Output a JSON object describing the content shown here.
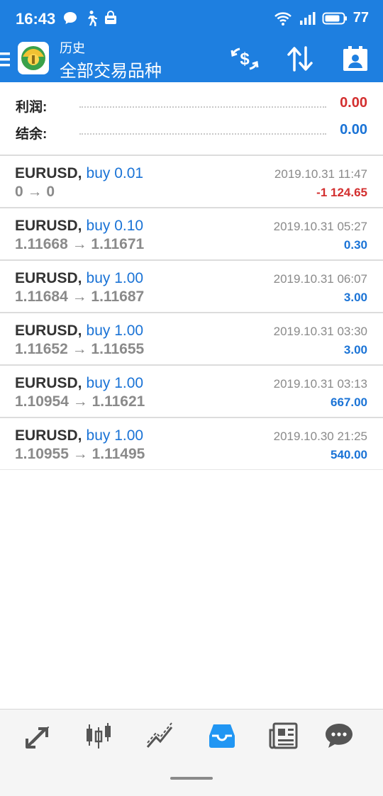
{
  "status_bar": {
    "time": "16:43",
    "battery": "77",
    "icons_left": [
      "chat-bubble-icon",
      "walking-icon",
      "bag-icon"
    ],
    "icons_right": [
      "wifi-icon",
      "signal-icon",
      "battery-icon"
    ]
  },
  "header": {
    "subtitle": "历史",
    "title": "全部交易品种",
    "actions": [
      "currency-exchange-icon",
      "sort-icon",
      "calendar-icon"
    ]
  },
  "summary": {
    "profit_label": "利润:",
    "profit_value": "0.00",
    "balance_label": "结余:",
    "balance_value": "0.00"
  },
  "trades": [
    {
      "symbol": "EURUSD,",
      "action": "buy 0.01",
      "prices": "0 → 0",
      "date": "2019.10.31 11:47",
      "profit": "-1 124.65",
      "profit_color": "#d32f2f"
    },
    {
      "symbol": "EURUSD,",
      "action": "buy 0.10",
      "prices": "1.11668 → 1.11671",
      "date": "2019.10.31 05:27",
      "profit": "0.30",
      "profit_color": "#1a73d6"
    },
    {
      "symbol": "EURUSD,",
      "action": "buy 1.00",
      "prices": "1.11684 → 1.11687",
      "date": "2019.10.31 06:07",
      "profit": "3.00",
      "profit_color": "#1a73d6"
    },
    {
      "symbol": "EURUSD,",
      "action": "buy 1.00",
      "prices": "1.11652 → 1.11655",
      "date": "2019.10.31 03:30",
      "profit": "3.00",
      "profit_color": "#1a73d6"
    },
    {
      "symbol": "EURUSD,",
      "action": "buy 1.00",
      "prices": "1.10954 → 1.11621",
      "date": "2019.10.31 03:13",
      "profit": "667.00",
      "profit_color": "#1a73d6"
    },
    {
      "symbol": "EURUSD,",
      "action": "buy 1.00",
      "prices": "1.10955 → 1.11495",
      "date": "2019.10.30 21:25",
      "profit": "540.00",
      "profit_color": "#1a73d6"
    }
  ],
  "bottom_nav": [
    {
      "icon": "quotes-arrows-icon",
      "active": false
    },
    {
      "icon": "candlestick-chart-icon",
      "active": false
    },
    {
      "icon": "trade-line-icon",
      "active": false
    },
    {
      "icon": "history-inbox-icon",
      "active": true
    },
    {
      "icon": "news-icon",
      "active": false
    },
    {
      "icon": "chat-icon",
      "active": false
    }
  ],
  "colors": {
    "brand": "#1e7fe0",
    "loss": "#d32f2f",
    "gain": "#1a73d6",
    "nav_active": "#2196f3",
    "nav_inactive": "#555555"
  }
}
